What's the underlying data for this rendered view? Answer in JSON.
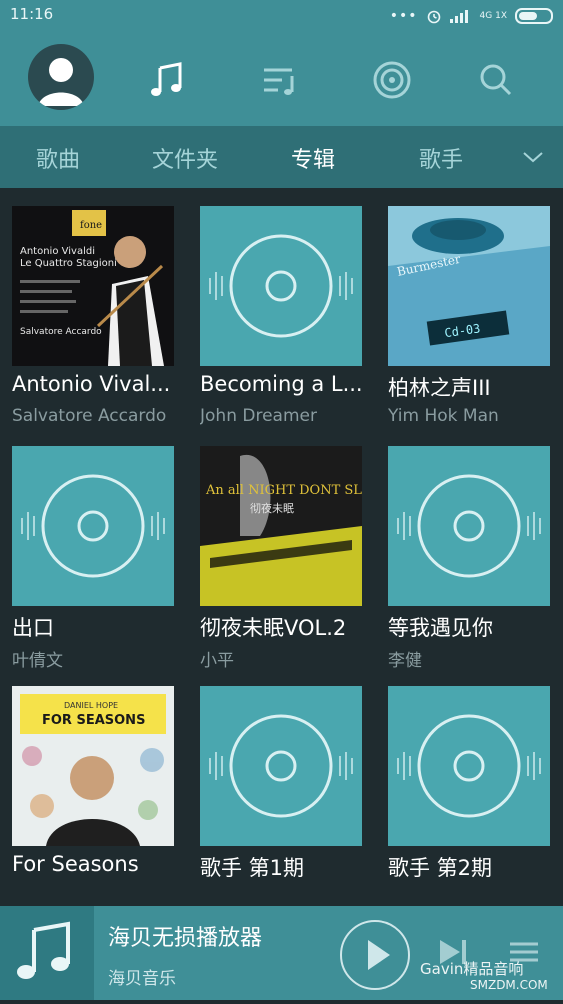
{
  "status": {
    "time": "11:16",
    "network": "4G 1X"
  },
  "nav": {
    "icons": [
      "avatar-icon",
      "music-note-icon",
      "playlist-icon",
      "radio-icon",
      "search-icon"
    ]
  },
  "tabs": [
    {
      "label": "歌曲"
    },
    {
      "label": "文件夹"
    },
    {
      "label": "专辑"
    },
    {
      "label": "歌手"
    }
  ],
  "active_tab": "专辑",
  "albums": [
    {
      "title": "Antonio Vival...",
      "artist": "Salvatore Accardo"
    },
    {
      "title": "Becoming a L...",
      "artist": "John Dreamer"
    },
    {
      "title": "柏林之声III",
      "artist": "Yim Hok Man"
    },
    {
      "title": "出口",
      "artist": "叶倩文"
    },
    {
      "title": "彻夜未眠VOL.2",
      "artist": "小平"
    },
    {
      "title": "等我遇见你",
      "artist": "李健"
    },
    {
      "title": "For Seasons",
      "artist": ""
    },
    {
      "title": "歌手 第1期",
      "artist": ""
    },
    {
      "title": "歌手 第2期",
      "artist": ""
    }
  ],
  "art_text": {
    "vivaldi_title_1": "Antonio Vivaldi",
    "vivaldi_title_2": "Le Quattro Stagioni",
    "vivaldi_performer": "Salvatore Accardo",
    "vivaldi_label": "fone",
    "burm_text": "Burmester",
    "burm_display": "Cd-03",
    "night_title": "An all NIGHT DONT SLEEP",
    "night_cn": "彻夜未眠",
    "seasons_artist": "DANIEL HOPE",
    "seasons_title": "FOR SEASONS"
  },
  "player": {
    "song": "海贝无损播放器",
    "artist": "海贝音乐",
    "watermark_1": "Gavin精品音响",
    "watermark_2": "SMZDM.COM"
  },
  "colors": {
    "accent": "#3f8f97",
    "tabs_bg": "#2f6f76",
    "grid_bg": "#1f2b2f",
    "placeholder": "#4aa7af"
  }
}
